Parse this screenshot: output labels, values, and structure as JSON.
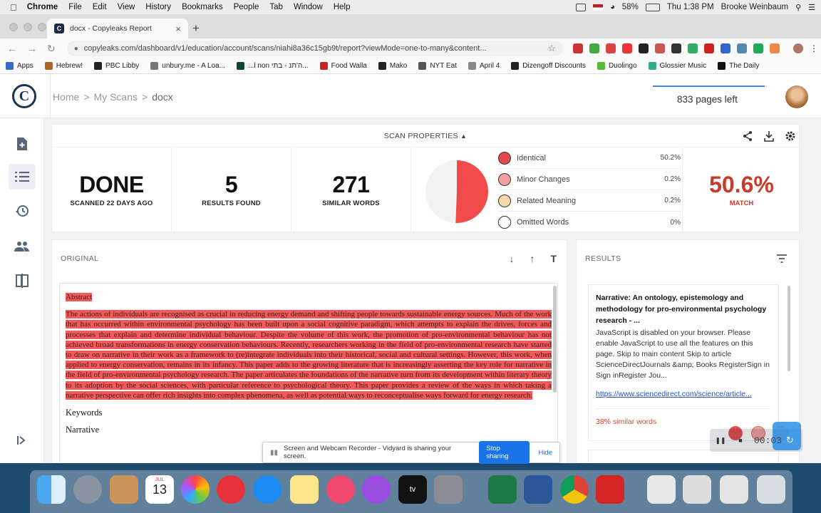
{
  "menubar": {
    "app": "Chrome",
    "items": [
      "File",
      "Edit",
      "View",
      "History",
      "Bookmarks",
      "People",
      "Tab",
      "Window",
      "Help"
    ],
    "battery": "58%",
    "clock": "Thu 1:38 PM",
    "user": "Brooke Weinbaum"
  },
  "browser": {
    "tab_title": "docx - Copyleaks Report",
    "url": "copyleaks.com/dashboard/v1/education/account/scans/niahi8a36c15gb9t/report?viewMode=one-to-many&content...",
    "bookmarks": [
      "Apps",
      "Hebrew!",
      "PBC Libby",
      "unbury.me - A Loa...",
      "...l non ה'תנ - בתי...",
      "Food Walla",
      "Mako",
      "NYT Eat",
      "April 4",
      "Dizengoff Discounts",
      "Duolingo",
      "Glossier Music",
      "The Daily"
    ]
  },
  "header": {
    "breadcrumbs": [
      "Home",
      "My Scans",
      "docx"
    ],
    "sep": ">",
    "pages_left": "833 pages left",
    "pages_fill": 0.98
  },
  "props": {
    "title": "SCAN PROPERTIES",
    "status": {
      "value": "DONE",
      "label": "SCANNED 22 DAYS AGO"
    },
    "results": {
      "value": "5",
      "label": "RESULTS FOUND"
    },
    "similar": {
      "value": "271",
      "label": "SIMILAR WORDS"
    },
    "legend": [
      {
        "label": "Identical",
        "pct": "50.2%",
        "color": "#e24b4b"
      },
      {
        "label": "Minor Changes",
        "pct": "0.2%",
        "color": "#f0a1a1"
      },
      {
        "label": "Related Meaning",
        "pct": "0.2%",
        "color": "#f6d7a7"
      },
      {
        "label": "Omitted Words",
        "pct": "0%",
        "color": "#ffffff"
      }
    ],
    "match": {
      "value": "50.6%",
      "label": "MATCH"
    }
  },
  "original": {
    "label": "ORIGINAL",
    "heading": "Abstract",
    "body": "The actions of individuals are recognised as crucial in reducing energy demand and shifting people towards sustainable energy sources. Much of the work that has occurred within environmental psychology has been built upon a social cognitive paradigm, which attempts to explain the drives, forces and processes that explain and determine individual behaviour. Despite the volume of this work, the promotion of pro-environmental behaviour has not achieved broad transformations in energy conservation behaviours. Recently, researchers working in the field of pro-environmental research have started to draw on narrative in their work as a framework to (re)integrate individuals into their historical, social and cultural settings. However, this work, when applied to energy conservation, remains in its infancy. This paper adds to the growing literature that is increasingly asserting the key role for narrative in the field of pro-environmental psychology research. The paper articulates the foundations of the narrative turn from its development within literary theory to its adoption by the social sciences, with particular reference to psychological theory. This paper provides a review of the ways in which taking a narrative perspective can offer rich insights into complex phenomena, as well as potential ways to reconceptualise ways forward for energy research.",
    "keywords_label": "Keywords",
    "keyword1": "Narrative"
  },
  "results": {
    "label": "RESULTS",
    "item": {
      "title": "Narrative: An ontology, epistemology and methodology for pro-environmental psychology research - ...",
      "snippet": "JavaScript is disabled on your browser. Please enable JavaScript to use all the features on this page. Skip to main content Skip to article ScienceDirectJournals &amp; Books RegisterSign in Sign inRegister Jou...",
      "url": "https://www.sciencedirect.com/science/article...",
      "similar": "38% similar words"
    }
  },
  "recorder": {
    "share_text": "Screen and Webcam Recorder - Vidyard is sharing your screen.",
    "stop": "Stop sharing",
    "hide": "Hide",
    "time": "00:03"
  },
  "dock": {
    "calendar_month": "JUL",
    "calendar_day": "13",
    "tv": "tv"
  }
}
